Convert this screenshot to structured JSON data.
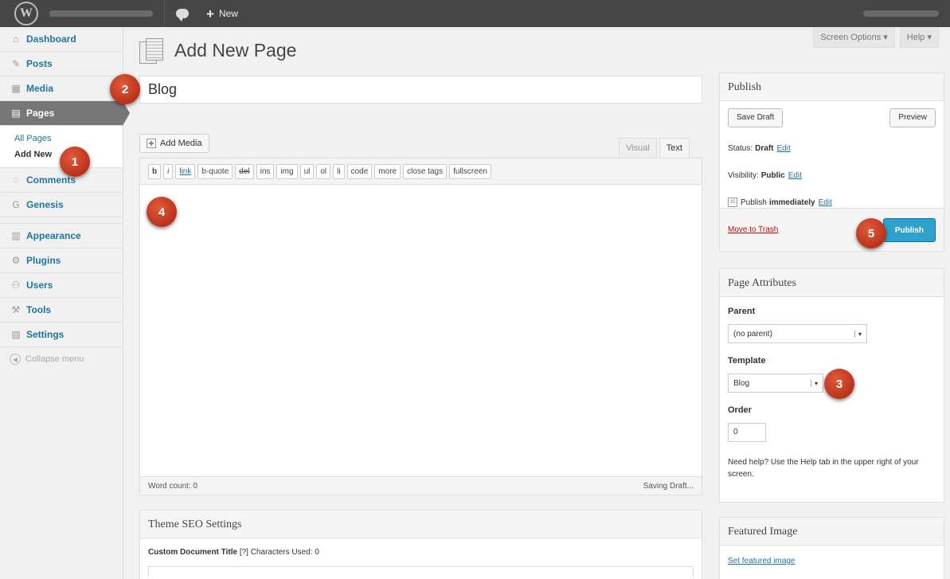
{
  "adminbar": {
    "logo": "W",
    "new_label": "New",
    "new_icon": "plus-icon"
  },
  "sidebar": {
    "items": [
      {
        "label": "Dashboard",
        "icon": "⌂"
      },
      {
        "label": "Posts",
        "icon": "✎"
      },
      {
        "label": "Media",
        "icon": "▦"
      },
      {
        "label": "Pages",
        "icon": "▤"
      },
      {
        "label": "Comments",
        "icon": "◌"
      },
      {
        "label": "Genesis",
        "icon": "G"
      },
      {
        "label": "Appearance",
        "icon": "▥"
      },
      {
        "label": "Plugins",
        "icon": "⚙"
      },
      {
        "label": "Users",
        "icon": "⚇"
      },
      {
        "label": "Tools",
        "icon": "⚒"
      },
      {
        "label": "Settings",
        "icon": "▧"
      }
    ],
    "submenu": [
      "All Pages",
      "Add New"
    ],
    "collapse": "Collapse menu"
  },
  "screen_options": "Screen Options ▾",
  "help": "Help ▾",
  "page_title": "Add New Page",
  "post_title": "Blog",
  "add_media": "Add Media",
  "editor_tabs": [
    "Visual",
    "Text"
  ],
  "quicktags": [
    "b",
    "i",
    "link",
    "b-quote",
    "del",
    "ins",
    "img",
    "ul",
    "ol",
    "li",
    "code",
    "more",
    "close tags",
    "fullscreen"
  ],
  "editor_status": {
    "word_count": "Word count: 0",
    "saving": "Saving Draft..."
  },
  "seo": {
    "title": "Theme SEO Settings",
    "field_label": "Custom Document Title",
    "help_mark": "[?]",
    "chars": "Characters Used: 0"
  },
  "publish": {
    "title": "Publish",
    "save_draft": "Save Draft",
    "preview": "Preview",
    "status_label": "Status:",
    "status_value": "Draft",
    "visibility_label": "Visibility:",
    "visibility_value": "Public",
    "publish_label": "Publish",
    "publish_value": "immediately",
    "edit": "Edit",
    "trash": "Move to Trash",
    "publish_button": "Publish"
  },
  "attributes": {
    "title": "Page Attributes",
    "parent_label": "Parent",
    "parent_value": "(no parent)",
    "template_label": "Template",
    "template_value": "Blog",
    "order_label": "Order",
    "order_value": "0",
    "help": "Need help? Use the Help tab in the upper right of your screen."
  },
  "featured": {
    "title": "Featured Image",
    "link": "Set featured image"
  },
  "callouts": [
    "1",
    "2",
    "3",
    "4",
    "5"
  ]
}
